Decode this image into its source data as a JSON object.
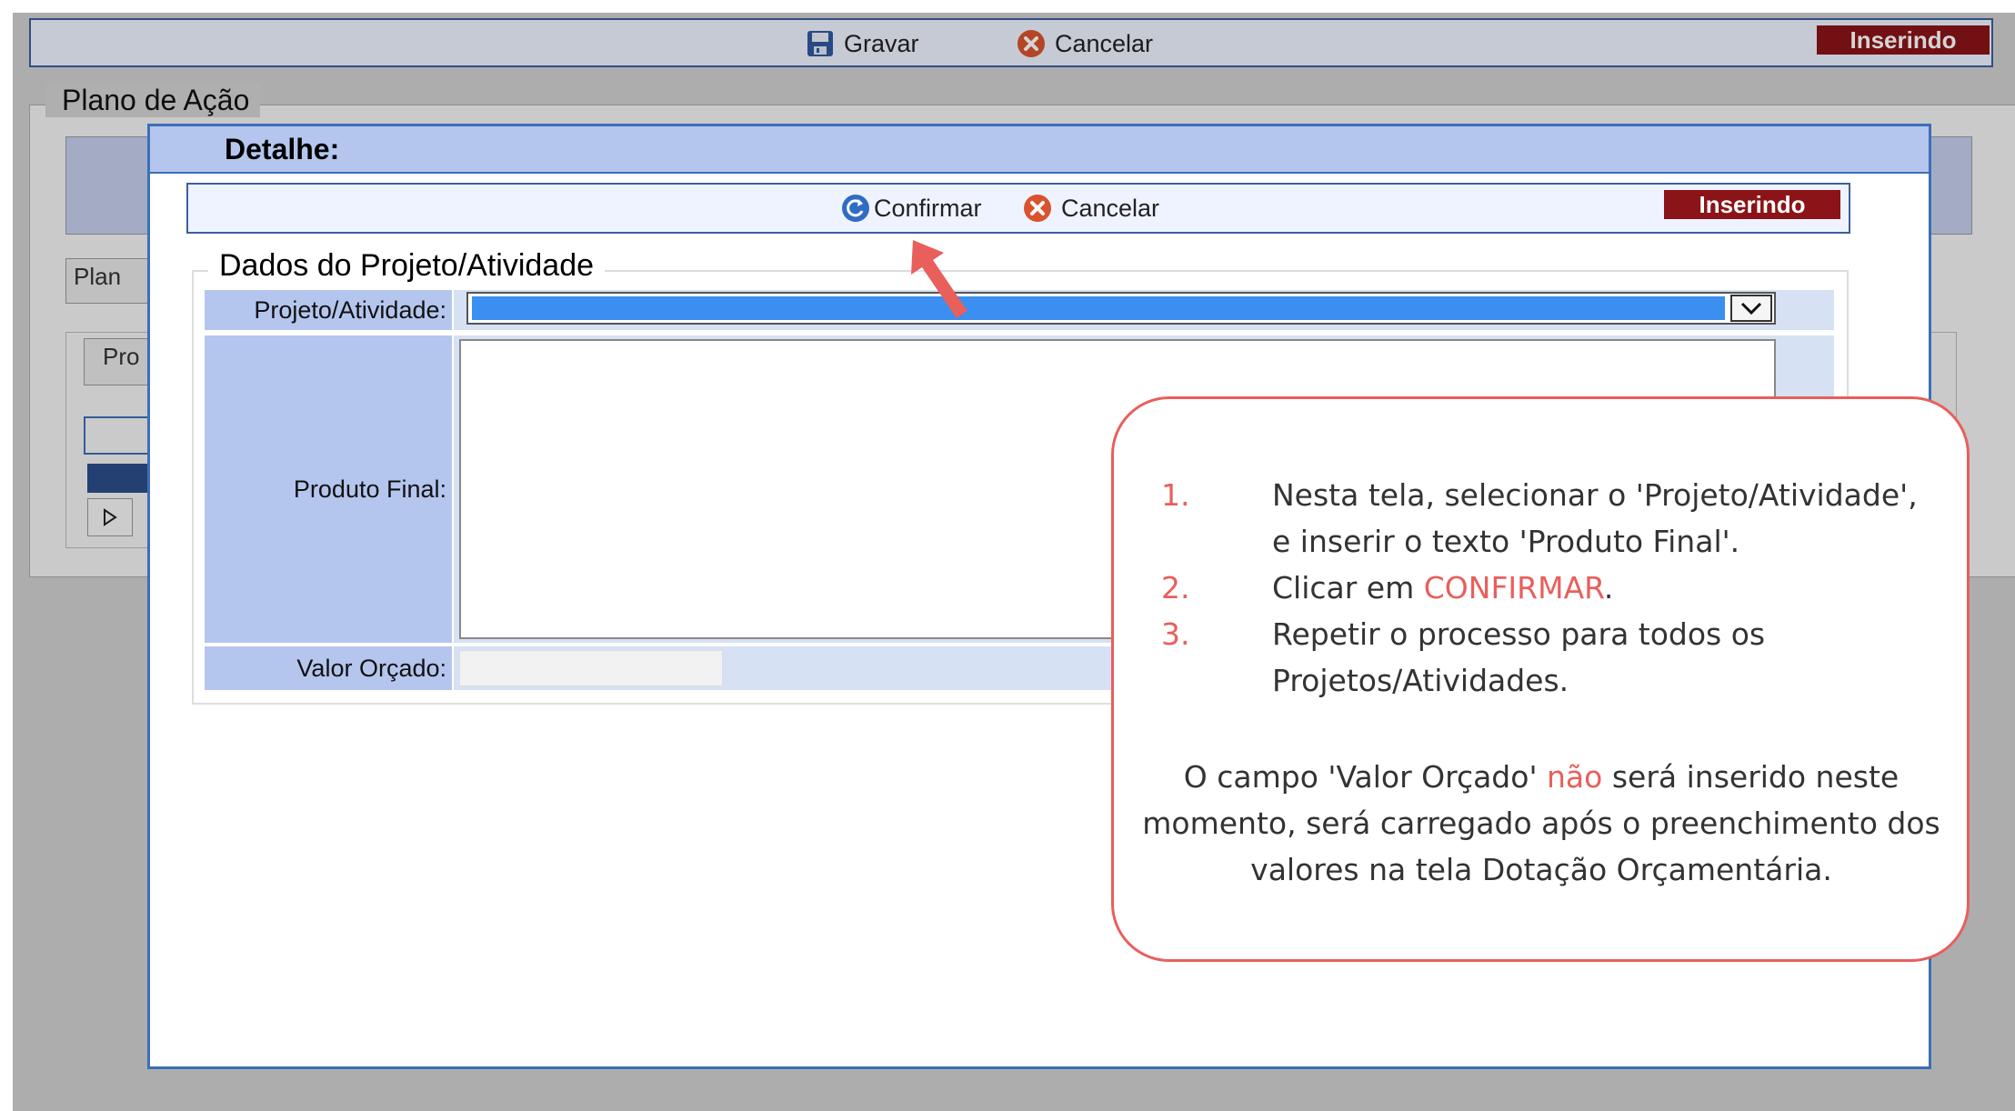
{
  "background": {
    "toolbar": {
      "save_label": "Gravar",
      "cancel_label": "Cancelar",
      "status": "Inserindo"
    },
    "section_title": "Plano de Ação",
    "tab_plan_partial": "Plan",
    "tab_pro_partial": "Pro"
  },
  "dialog": {
    "title": "Detalhe:",
    "toolbar": {
      "confirm_label": "Confirmar",
      "cancel_label": "Cancelar",
      "status": "Inserindo"
    },
    "fieldset_title": "Dados do Projeto/Atividade",
    "fields": {
      "projeto_label": "Projeto/Atividade:",
      "projeto_value": "",
      "produto_label": "Produto Final:",
      "produto_value": "",
      "valor_label": "Valor Orçado:",
      "valor_value": ""
    }
  },
  "callout": {
    "steps": [
      {
        "num": "1.",
        "text": "Nesta tela, selecionar o 'Projeto/Atividade', e inserir o texto 'Produto Final'."
      },
      {
        "num": "2.",
        "text_before": "Clicar em ",
        "highlight": "CONFIRMAR",
        "text_after": "."
      },
      {
        "num": "3.",
        "text": "Repetir o processo para todos os Projetos/Atividades."
      }
    ],
    "note_before": "O campo 'Valor Orçado' ",
    "note_highlight": "não",
    "note_after": " será inserido neste momento, será carregado após o preenchimento dos valores na tela Dotação Orçamentária."
  },
  "colors": {
    "accent_red": "#e85f5c",
    "badge_bg": "#8b1418",
    "dialog_title_bg": "#b5c6ee",
    "select_highlight": "#3a8ff0"
  },
  "icons": [
    "floppy-disk-icon",
    "cancel-x-icon",
    "confirm-refresh-icon",
    "chevron-down-icon",
    "chevron-up-icon",
    "play-triangle-icon"
  ]
}
